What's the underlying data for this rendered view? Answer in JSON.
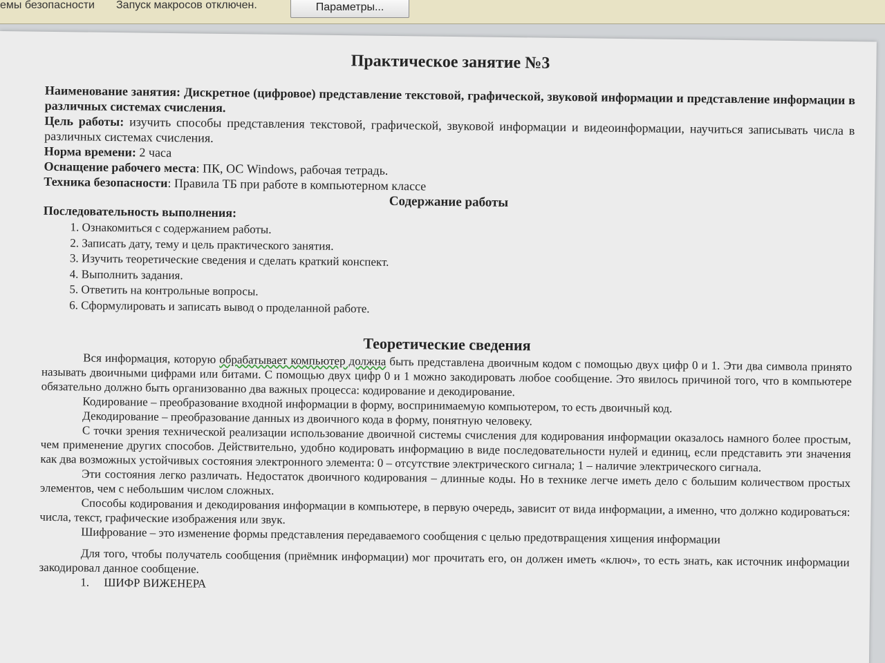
{
  "security_bar": {
    "label": "емы безопасности",
    "message": "Запуск макросов отключен.",
    "options_button": "Параметры..."
  },
  "document": {
    "title": "Практическое занятие №3",
    "lesson_name_label": "Наименование занятия:",
    "lesson_name_value": "Дискретное (цифровое) представление текстовой, графической, звуковой информации и представление информации в различных системах счисления.",
    "goal_label": "Цель работы:",
    "goal_value": "изучить способы представления текстовой, графической, звуковой информации и видеоинформации, научиться записывать числа в различных системах счисления.",
    "time_label": "Норма времени:",
    "time_value": "2 часа",
    "equipment_label": "Оснащение рабочего места",
    "equipment_value": ": ПК, ОС Windows, рабочая тетрадь.",
    "safety_label": "Техника безопасности",
    "safety_value": ": Правила ТБ при работе в компьютерном классе",
    "content_heading": "Содержание работы",
    "sequence_label": "Последовательность выполнения",
    "sequence_colon": ":",
    "steps": [
      "Ознакомиться с содержанием работы.",
      "Записать дату, тему и цель практического занятия.",
      "Изучить теоретические сведения и сделать краткий конспект.",
      "Выполнить задания.",
      "Ответить на контрольные вопросы.",
      "Сформулировать и записать вывод о проделанной работе."
    ],
    "theory_heading": "Теоретические сведения",
    "theory": {
      "p1_start": "Вся информация, которую ",
      "p1_wavy": "обрабатывает компьютер должна",
      "p1_end": " быть представлена двоичным кодом с помощью двух цифр 0 и 1. Эти два символа принято называть двоичными цифрами или битами. С помощью двух цифр 0 и 1 можно закодировать любое сообщение. Это явилось причиной того, что в компьютере обязательно должно быть организованно два важных процесса: кодирование и декодирование.",
      "p2": "Кодирование – преобразование входной информации в форму, воспринимаемую компьютером, то есть двоичный код.",
      "p3": "Декодирование – преобразование данных из двоичного кода в форму, понятную человеку.",
      "p4": "С точки зрения технической реализации использование двоичной системы счисления для кодирования информации оказалось намного более простым, чем применение других способов. Действительно, удобно кодировать информацию в виде последовательности нулей и единиц, если представить эти значения как два возможных устойчивых состояния электронного элемента: 0 – отсутствие электрического сигнала; 1 – наличие электрического сигнала.",
      "p5": "Эти состояния легко различать. Недостаток двоичного кодирования – длинные коды. Но в технике легче иметь дело с большим количеством простых элементов, чем с небольшим числом сложных.",
      "p6": "Способы кодирования и декодирования информации в компьютере, в первую очередь, зависит от вида информации, а именно, что должно кодироваться: числа, текст, графические изображения или звук.",
      "p7": "Шифрование – это изменение формы представления передаваемого сообщения с целью предотвращения хищения информации",
      "p8": "Для того, чтобы получатель сообщения (приёмник информации) мог прочитать его, он должен иметь «ключ», то есть знать, как источник информации закодировал данное сообщение.",
      "item1_num": "1.",
      "item1": "ШИФР ВИЖЕНЕРА"
    }
  }
}
